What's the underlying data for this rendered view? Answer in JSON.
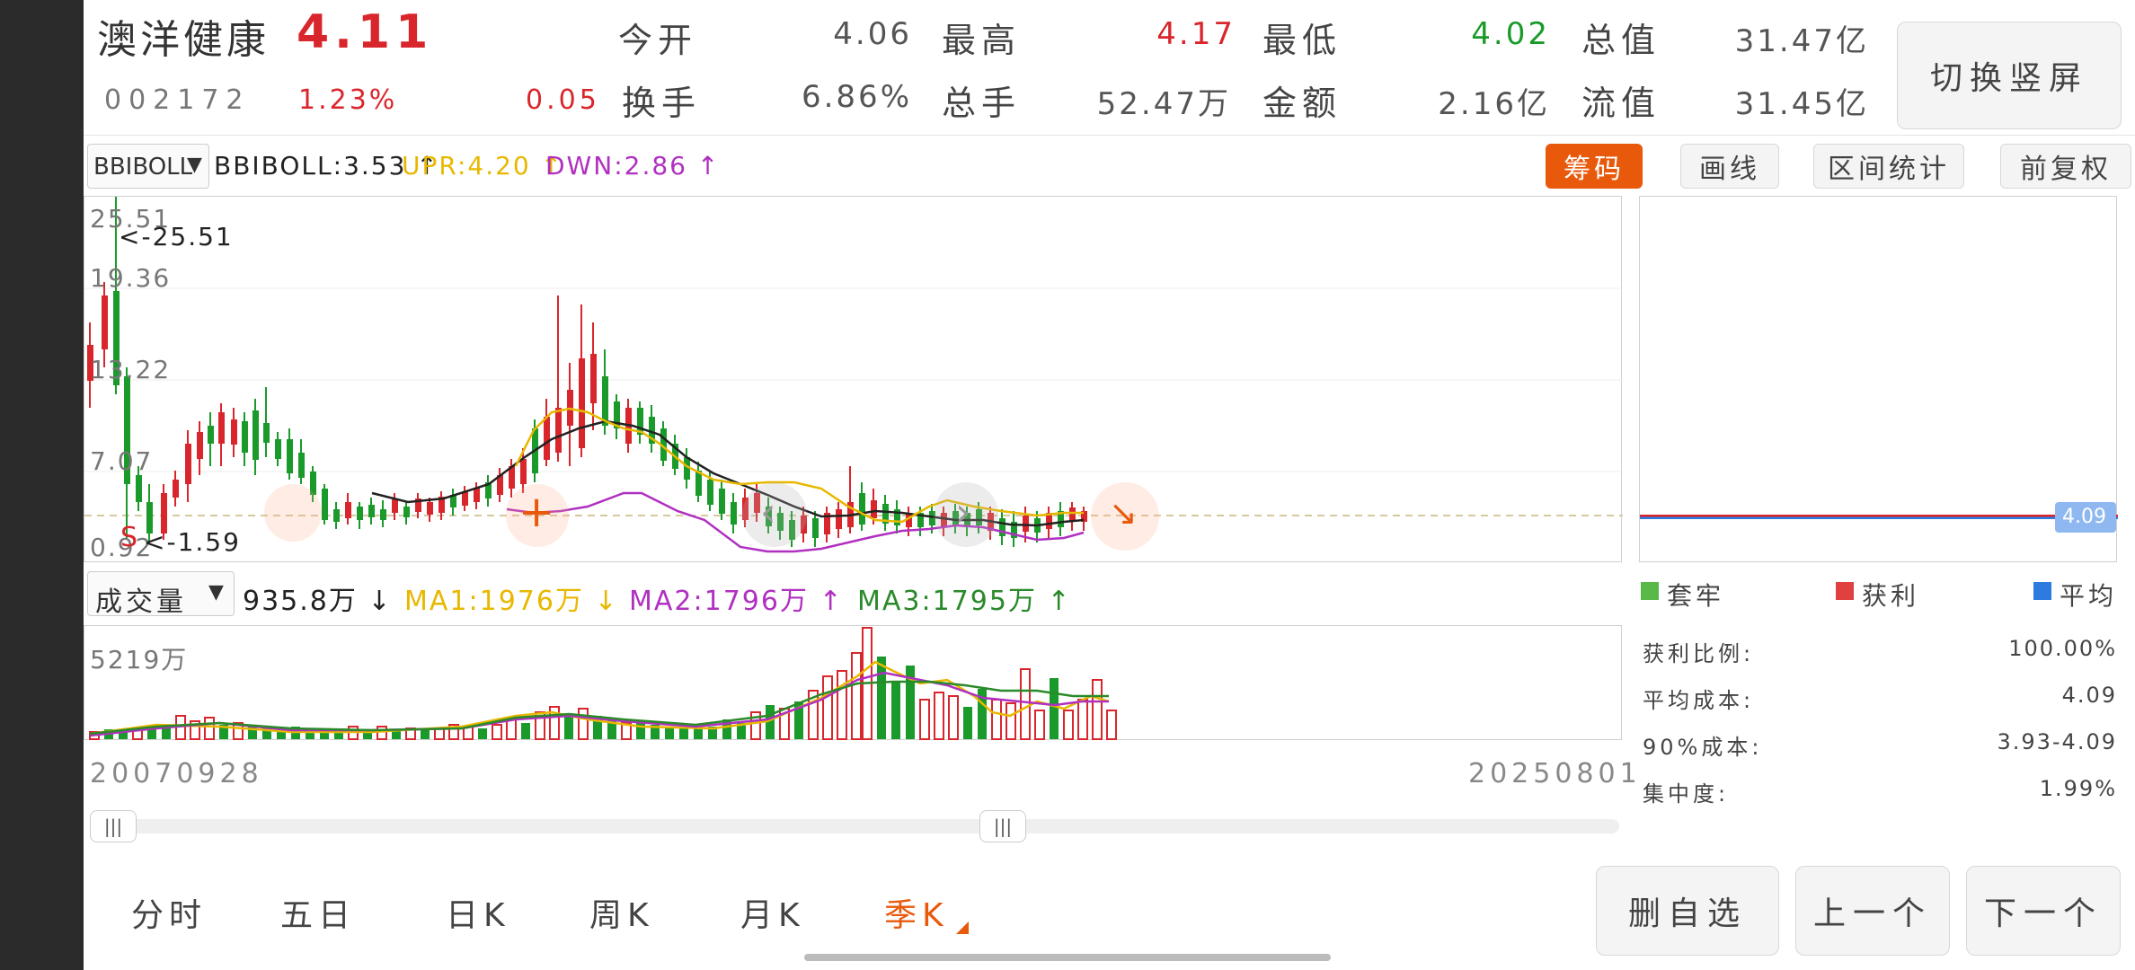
{
  "stock": {
    "name": "澳洋健康",
    "price": "4.11",
    "code": "002172",
    "change_pct": "1.23%",
    "change_amt": "0.05"
  },
  "quote": {
    "open_label": "今开",
    "open": "4.06",
    "high_label": "最高",
    "high": "4.17",
    "low_label": "最低",
    "low": "4.02",
    "total_cap_label": "总值",
    "total_cap": "31.47亿",
    "turnover_label": "换手",
    "turnover": "6.86%",
    "volume_label": "总手",
    "volume": "52.47万",
    "amount_label": "金额",
    "amount": "2.16亿",
    "float_cap_label": "流值",
    "float_cap": "31.45亿"
  },
  "header_buttons": {
    "switch_portrait": "切换竖屏"
  },
  "indicator": {
    "select": "BBIBOLL",
    "bbiboll": "BBIBOLL:3.53 ↑",
    "upr": "UPR:4.20 ↑",
    "dwn": "DWN:2.86 ↑"
  },
  "toolbar": {
    "chips": "筹码",
    "draw": "画线",
    "range_stats": "区间统计",
    "adjust": "前复权"
  },
  "price_axis": {
    "max_label": "25.51",
    "max_marker": "<-25.51",
    "y2": "19.36",
    "y3": "13.22",
    "y4": "7.07",
    "min_label": "0.92",
    "min_marker": "<-1.59",
    "s_marker": "S"
  },
  "volume": {
    "select": "成交量",
    "value": "935.8万 ↓",
    "ma1": "MA1:1976万 ↓",
    "ma2": "MA2:1796万 ↑",
    "ma3": "MA3:1795万 ↑",
    "max_label": "5219万"
  },
  "dates": {
    "start": "20070928",
    "end": "20250801"
  },
  "chips_panel": {
    "price_tag": "4.09",
    "legend_trapped": "套牢",
    "legend_profit": "获利",
    "legend_avg": "平均",
    "profit_ratio_label": "获利比例:",
    "profit_ratio": "100.00%",
    "avg_cost_label": "平均成本:",
    "avg_cost": "4.09",
    "cost90_label": "90%成本:",
    "cost90": "3.93-4.09",
    "concentration_label": "集中度:",
    "concentration": "1.99%"
  },
  "period_tabs": [
    "分时",
    "五日",
    "日K",
    "周K",
    "月K",
    "季K"
  ],
  "bottom_buttons": {
    "remove_watch": "删自选",
    "prev": "上一个",
    "next": "下一个"
  },
  "colors": {
    "up": "#d9262c",
    "down": "#1a9a2a",
    "accent": "#e8590c",
    "mid_line": "#222222",
    "upper_line": "#e8b800",
    "lower_line": "#b030c0",
    "ma1": "#e8b800",
    "ma2": "#b030c0",
    "ma3": "#2a8a2a"
  }
}
